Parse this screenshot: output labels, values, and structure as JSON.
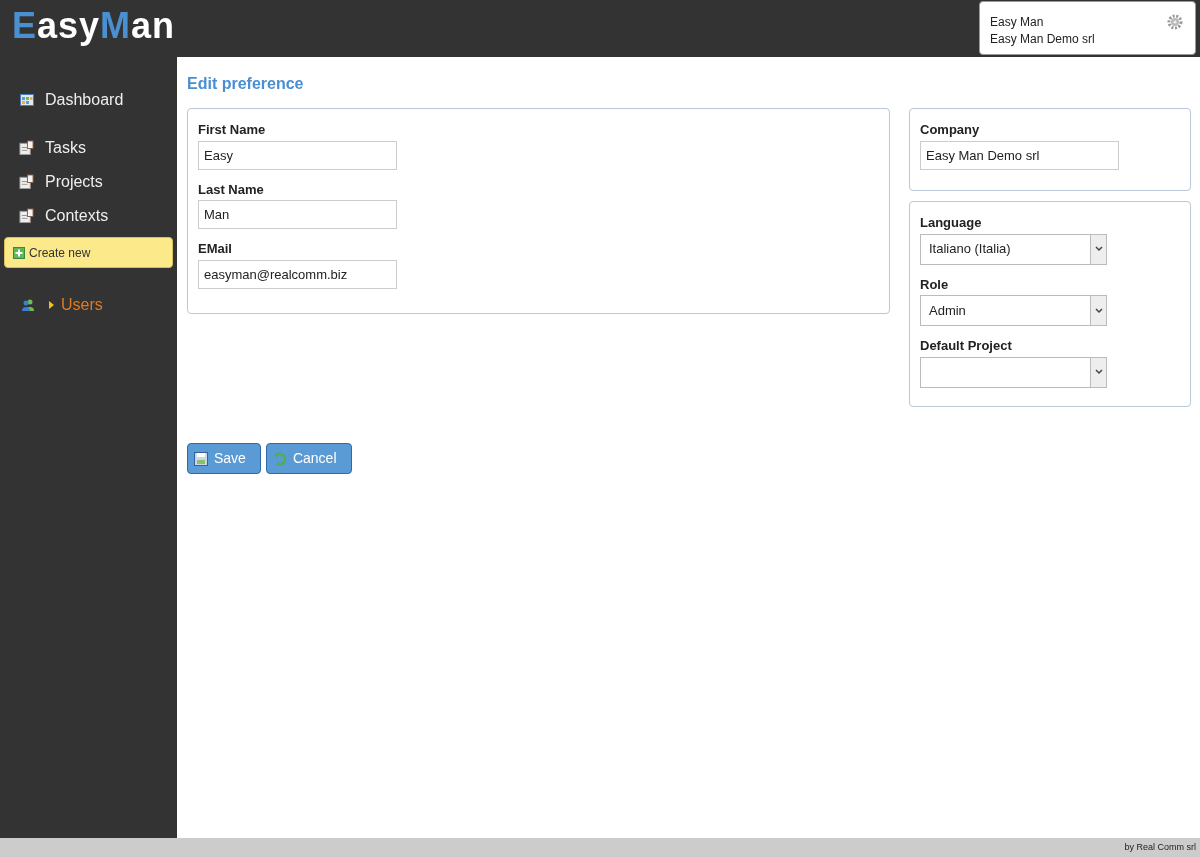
{
  "logo": [
    {
      "text": "E",
      "accent": true
    },
    {
      "text": "asy",
      "accent": false
    },
    {
      "text": "M",
      "accent": true
    },
    {
      "text": "an",
      "accent": false
    }
  ],
  "user_box": {
    "name": "Easy Man",
    "company": "Easy Man Demo srl"
  },
  "sidebar": {
    "items": [
      {
        "kind": "link",
        "label": "Dashboard",
        "active": false
      },
      {
        "kind": "link",
        "label": "Tasks",
        "active": false
      },
      {
        "kind": "link",
        "label": "Projects",
        "active": false
      },
      {
        "kind": "link",
        "label": "Contexts",
        "active": false
      },
      {
        "kind": "create",
        "label": "Create new",
        "active": false
      },
      {
        "kind": "group",
        "label": "Users",
        "active": true,
        "expanded": false
      }
    ]
  },
  "page_title": "Edit preference",
  "main_fields": [
    {
      "label": "First Name",
      "value": "Easy"
    },
    {
      "label": "Last Name",
      "value": "Man"
    },
    {
      "label": "EMail",
      "value": "easyman@realcomm.biz"
    }
  ],
  "company_field": {
    "label": "Company",
    "value": "Easy Man Demo srl"
  },
  "selects": [
    {
      "label": "Language",
      "value": "Italiano (Italia)"
    },
    {
      "label": "Role",
      "value": "Admin"
    },
    {
      "label": "Default Project"
    }
  ],
  "buttons": [
    {
      "label": "Save"
    },
    {
      "label": "Cancel"
    }
  ],
  "footer": "by Real Comm srl"
}
